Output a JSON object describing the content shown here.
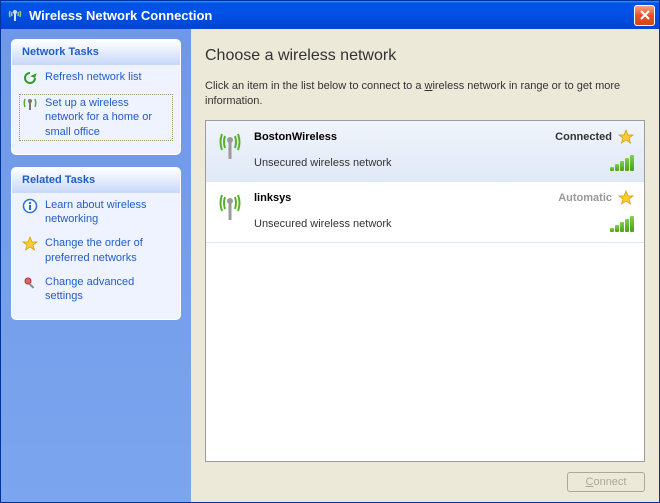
{
  "window": {
    "title": "Wireless Network Connection"
  },
  "sidebar": {
    "group1": {
      "title": "Network Tasks",
      "items": [
        {
          "label": "Refresh network list"
        },
        {
          "label": "Set up a wireless network for a home or small office"
        }
      ]
    },
    "group2": {
      "title": "Related Tasks",
      "items": [
        {
          "label": "Learn about wireless networking"
        },
        {
          "label": "Change the order of preferred networks"
        },
        {
          "label": "Change advanced settings"
        }
      ]
    }
  },
  "main": {
    "heading": "Choose a wireless network",
    "desc_pre": "Click an item in the list below to connect to a ",
    "desc_u": "w",
    "desc_post": "ireless network in range or to get more information.",
    "networks": [
      {
        "name": "BostonWireless",
        "status": "Connected",
        "status_gray": false,
        "security": "Unsecured wireless network"
      },
      {
        "name": "linksys",
        "status": "Automatic",
        "status_gray": true,
        "security": "Unsecured wireless network"
      }
    ],
    "connect_u": "C",
    "connect_post": "onnect"
  }
}
